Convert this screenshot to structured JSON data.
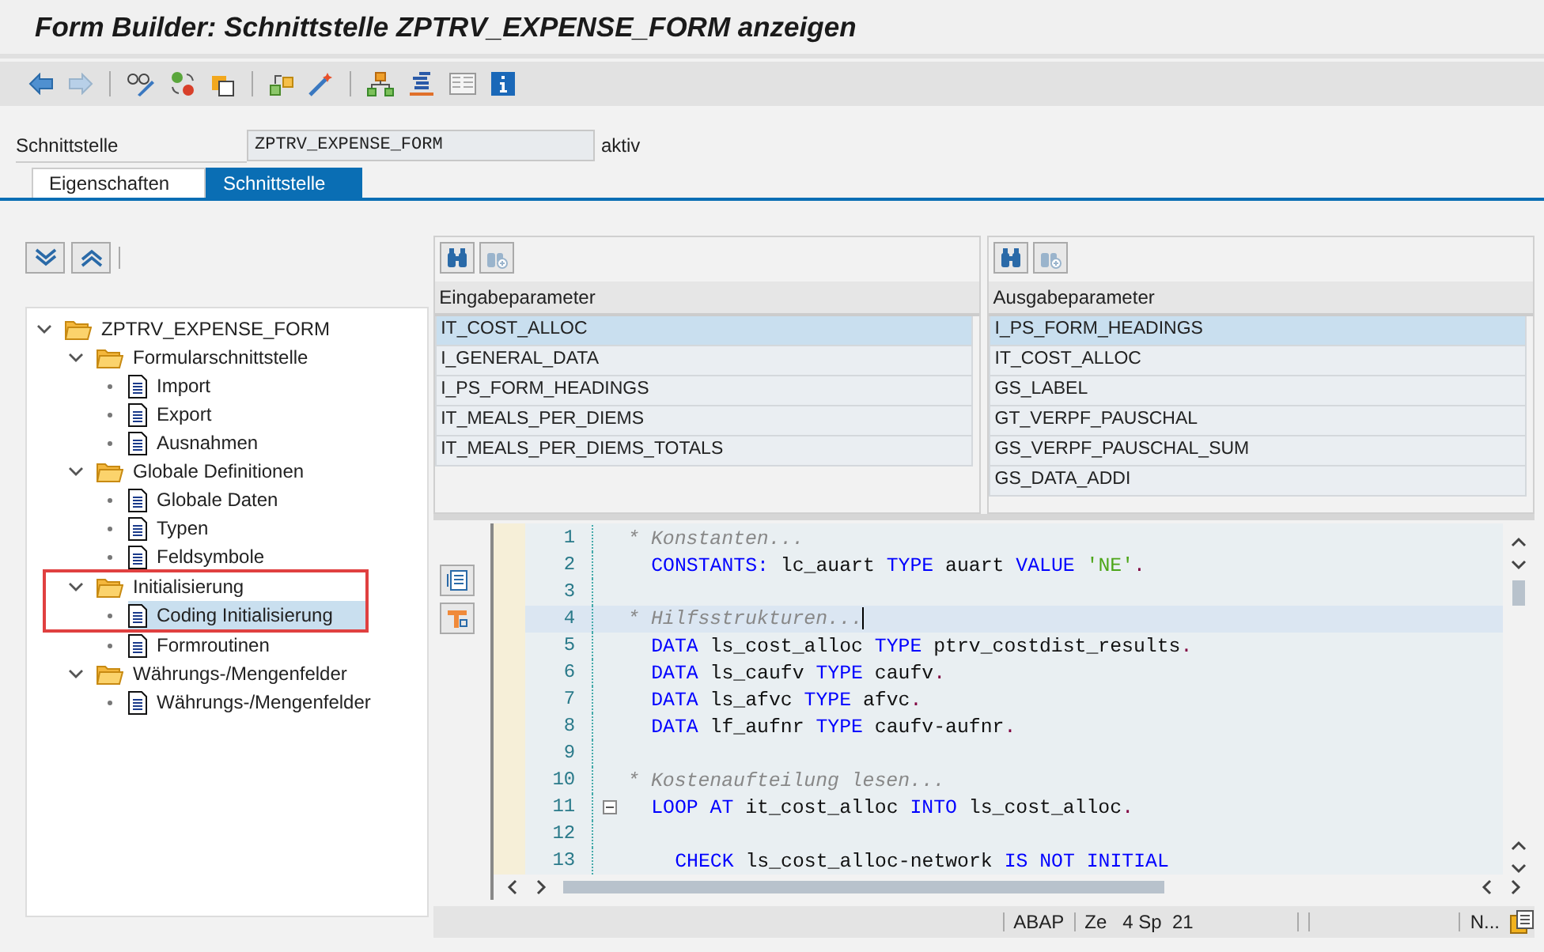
{
  "window": {
    "title": "Form Builder: Schnittstelle ZPTRV_EXPENSE_FORM anzeigen"
  },
  "header": {
    "label": "Schnittstelle",
    "value": "ZPTRV_EXPENSE_FORM",
    "status": "aktiv"
  },
  "tabs": [
    {
      "label": "Eigenschaften",
      "selected": false
    },
    {
      "label": "Schnittstelle",
      "selected": true
    }
  ],
  "tree": [
    {
      "label": "ZPTRV_EXPENSE_FORM",
      "kind": "folder",
      "expanded": true,
      "selected": false,
      "children": [
        {
          "label": "Formularschnittstelle",
          "kind": "folder",
          "expanded": true,
          "selected": false,
          "children": [
            {
              "label": "Import",
              "kind": "doc",
              "selected": false
            },
            {
              "label": "Export",
              "kind": "doc",
              "selected": false
            },
            {
              "label": "Ausnahmen",
              "kind": "doc",
              "selected": false
            }
          ]
        },
        {
          "label": "Globale Definitionen",
          "kind": "folder",
          "expanded": true,
          "selected": false,
          "children": [
            {
              "label": "Globale Daten",
              "kind": "doc",
              "selected": false
            },
            {
              "label": "Typen",
              "kind": "doc",
              "selected": false
            },
            {
              "label": "Feldsymbole",
              "kind": "doc",
              "selected": false
            }
          ]
        },
        {
          "label": "Initialisierung",
          "kind": "folder",
          "expanded": true,
          "selected": false,
          "framed": true,
          "children": [
            {
              "label": "Coding Initialisierung",
              "kind": "doc",
              "selected": true
            },
            {
              "label": "Formroutinen",
              "kind": "doc",
              "selected": false
            }
          ]
        },
        {
          "label": "Währungs-/Mengenfelder",
          "kind": "folder",
          "expanded": true,
          "selected": false,
          "children": [
            {
              "label": "Währungs-/Mengenfelder",
              "kind": "doc",
              "selected": false
            }
          ]
        }
      ]
    }
  ],
  "parameter_tables": [
    {
      "heading": "Eingabeparameter",
      "rows": [
        {
          "name": "IT_COST_ALLOC",
          "selected": true
        },
        {
          "name": "I_GENERAL_DATA",
          "selected": false
        },
        {
          "name": "I_PS_FORM_HEADINGS",
          "selected": false
        },
        {
          "name": "IT_MEALS_PER_DIEMS",
          "selected": false
        },
        {
          "name": "IT_MEALS_PER_DIEMS_TOTALS",
          "selected": false
        }
      ]
    },
    {
      "heading": "Ausgabeparameter",
      "rows": [
        {
          "name": "I_PS_FORM_HEADINGS",
          "selected": true
        },
        {
          "name": "IT_COST_ALLOC",
          "selected": false
        },
        {
          "name": "GS_LABEL",
          "selected": false
        },
        {
          "name": "GT_VERPF_PAUSCHAL",
          "selected": false
        },
        {
          "name": "GS_VERPF_PAUSCHAL_SUM",
          "selected": false
        },
        {
          "name": "GS_DATA_ADDI",
          "selected": false
        }
      ]
    }
  ],
  "code_lines": [
    {
      "number": "1",
      "kind": "comment",
      "current": false,
      "tokens": [
        {
          "kind": "comment",
          "text": "* Konstanten..."
        }
      ]
    },
    {
      "number": "2",
      "kind": "statement",
      "current": false,
      "tokens": [
        {
          "kind": "keyword",
          "text": "CONSTANTS:"
        },
        {
          "kind": "plain",
          "text": "lc_auart"
        },
        {
          "kind": "keyword",
          "text": "TYPE"
        },
        {
          "kind": "plain",
          "text": "auart"
        },
        {
          "kind": "keyword",
          "text": "VALUE"
        },
        {
          "kind": "string",
          "text": "'NE'"
        },
        {
          "kind": "punct",
          "text": "."
        }
      ]
    },
    {
      "number": "3",
      "kind": "blank",
      "current": false
    },
    {
      "number": "4",
      "kind": "comment",
      "current": true,
      "tokens": [
        {
          "kind": "comment",
          "text": "* Hilfsstrukturen..."
        }
      ]
    },
    {
      "number": "5",
      "kind": "statement",
      "current": false,
      "tokens": [
        {
          "kind": "keyword",
          "text": "DATA"
        },
        {
          "kind": "plain",
          "text": "ls_cost_alloc"
        },
        {
          "kind": "keyword",
          "text": "TYPE"
        },
        {
          "kind": "plain",
          "text": "ptrv_costdist_results"
        },
        {
          "kind": "punct",
          "text": "."
        }
      ]
    },
    {
      "number": "6",
      "kind": "statement",
      "current": false,
      "tokens": [
        {
          "kind": "keyword",
          "text": "DATA"
        },
        {
          "kind": "plain",
          "text": "ls_caufv"
        },
        {
          "kind": "keyword",
          "text": "TYPE"
        },
        {
          "kind": "plain",
          "text": "caufv"
        },
        {
          "kind": "punct",
          "text": "."
        }
      ]
    },
    {
      "number": "7",
      "kind": "statement",
      "current": false,
      "tokens": [
        {
          "kind": "keyword",
          "text": "DATA"
        },
        {
          "kind": "plain",
          "text": "ls_afvc"
        },
        {
          "kind": "keyword",
          "text": "TYPE"
        },
        {
          "kind": "plain",
          "text": "afvc"
        },
        {
          "kind": "punct",
          "text": "."
        }
      ]
    },
    {
      "number": "8",
      "kind": "statement",
      "current": false,
      "tokens": [
        {
          "kind": "keyword",
          "text": "DATA"
        },
        {
          "kind": "plain",
          "text": "lf_aufnr"
        },
        {
          "kind": "keyword",
          "text": "TYPE"
        },
        {
          "kind": "plain",
          "text": "caufv-aufnr"
        },
        {
          "kind": "punct",
          "text": "."
        }
      ]
    },
    {
      "number": "9",
      "kind": "blank",
      "current": false
    },
    {
      "number": "10",
      "kind": "comment",
      "current": false,
      "tokens": [
        {
          "kind": "comment",
          "text": "* Kostenaufteilung lesen..."
        }
      ]
    },
    {
      "number": "11",
      "kind": "statement",
      "current": false,
      "fold": true,
      "tokens": [
        {
          "kind": "keyword",
          "text": "LOOP AT"
        },
        {
          "kind": "plain",
          "text": "it_cost_alloc"
        },
        {
          "kind": "keyword",
          "text": "INTO"
        },
        {
          "kind": "plain",
          "text": "ls_cost_alloc"
        },
        {
          "kind": "punct",
          "text": "."
        }
      ]
    },
    {
      "number": "12",
      "kind": "blank",
      "current": false
    },
    {
      "number": "13",
      "kind": "nested",
      "current": false,
      "tokens": [
        {
          "kind": "keyword",
          "text": "CHECK"
        },
        {
          "kind": "plain",
          "text": "ls_cost_alloc-network"
        },
        {
          "kind": "keyword",
          "text": "IS NOT INITIAL"
        }
      ]
    }
  ],
  "status_bar": [
    {
      "text": "ABAP"
    },
    {
      "text": "Ze   4 Sp  21"
    },
    {
      "text": "N..."
    }
  ]
}
